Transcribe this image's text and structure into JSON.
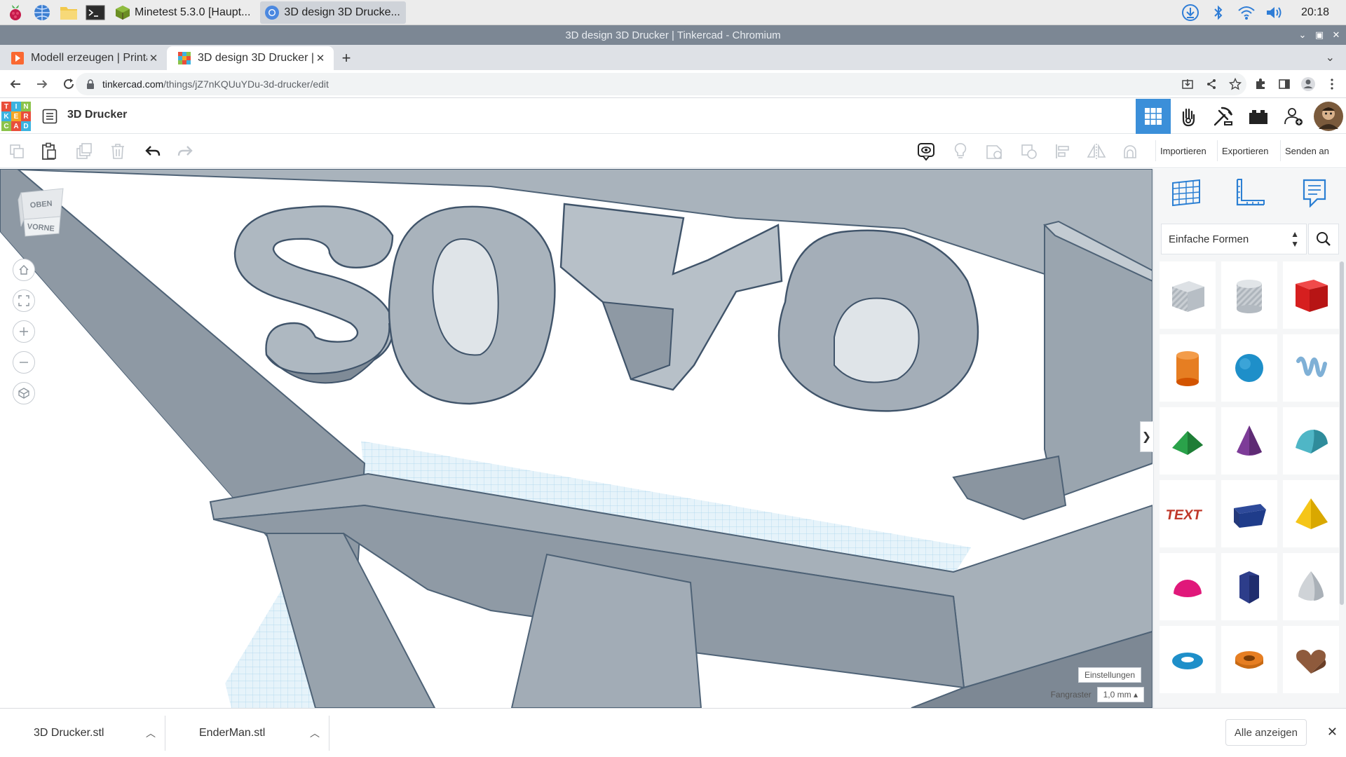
{
  "taskbar": {
    "tasks": [
      {
        "label": "Minetest 5.3.0 [Haupt...",
        "active": false
      },
      {
        "label": "3D design 3D Drucke...",
        "active": true
      }
    ],
    "clock": "20:18"
  },
  "window": {
    "title": "3D design 3D Drucker | Tinkercad - Chromium"
  },
  "browser": {
    "tabs": [
      {
        "title": "Modell erzeugen | Printal",
        "active": false
      },
      {
        "title": "3D design 3D Drucker | T",
        "active": true
      }
    ],
    "url_host": "tinkercad.com",
    "url_path": "/things/jZ7nKQUuYDu-3d-drucker/edit"
  },
  "tinkercad": {
    "logo_letters": [
      "T",
      "I",
      "N",
      "K",
      "E",
      "R",
      "C",
      "A",
      "D"
    ],
    "design_title": "3D Drucker",
    "toolbar": {
      "import_label": "Importieren",
      "export_label": "Exportieren",
      "send_label": "Senden an"
    },
    "viewcube": {
      "top": "OBEN",
      "front": "VORNE"
    },
    "settings_label": "Einstellungen",
    "snap_label": "Fangraster",
    "snap_value": "1,0 mm",
    "panel": {
      "category": "Einfache Formen",
      "shapes": [
        "box-hole",
        "cylinder-hole",
        "box",
        "cylinder",
        "sphere",
        "scribble",
        "roof",
        "cone",
        "round-roof",
        "text",
        "wedge",
        "pyramid",
        "half-sphere",
        "polygon",
        "paraboloid",
        "torus",
        "tube",
        "heart"
      ]
    }
  },
  "downloads": {
    "items": [
      "3D Drucker.stl",
      "EnderMan.stl"
    ],
    "show_all_label": "Alle anzeigen"
  }
}
